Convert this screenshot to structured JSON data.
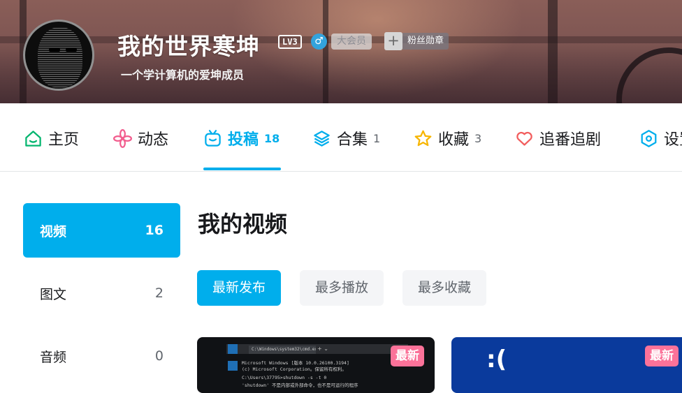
{
  "profile": {
    "name": "我的世界寒坤",
    "level": "LV3",
    "gender_symbol": "♂",
    "vip": "大会员",
    "fan_badge_plus": "+",
    "fan_badge": "粉丝勋章",
    "bio": "一个学计算机的爱坤成员"
  },
  "tabs": [
    {
      "label": "主页",
      "count": "",
      "icon": "home-icon",
      "color": "#04b56f"
    },
    {
      "label": "动态",
      "count": "",
      "icon": "dynamic-icon",
      "color": "#f25d8e"
    },
    {
      "label": "投稿",
      "count": "18",
      "icon": "tv-icon",
      "color": "#00aeec",
      "active": true
    },
    {
      "label": "合集",
      "count": "1",
      "icon": "layers-icon",
      "color": "#00aeec"
    },
    {
      "label": "收藏",
      "count": "3",
      "icon": "star-icon",
      "color": "#f7b500"
    },
    {
      "label": "追番追剧",
      "count": "",
      "icon": "heart-icon",
      "color": "#f25d5d"
    },
    {
      "label": "设置",
      "count": "",
      "icon": "settings-icon",
      "color": "#00aeec"
    }
  ],
  "sidebar": {
    "items": [
      {
        "label": "视频",
        "count": "16",
        "active": true
      },
      {
        "label": "图文",
        "count": "2"
      },
      {
        "label": "音频",
        "count": "0"
      }
    ]
  },
  "main": {
    "title": "我的视频",
    "sort": [
      {
        "label": "最新发布",
        "active": true
      },
      {
        "label": "最多播放"
      },
      {
        "label": "最多收藏"
      }
    ],
    "videos": [
      {
        "badge": "最新",
        "cmd_title": "C:\\Windows\\system32\\cmd.exe",
        "cmd_plus": "+  ⌄",
        "lines": [
          "Microsoft Windows [版本 10.0.26100.3194]",
          "(c) Microsoft Corporation。保留所有权利。",
          "C:\\Users\\37795>shutdown -s -t 0",
          "'shutdown' 不是内部或外部命令，也不是可运行的程序"
        ]
      },
      {
        "badge": "最新",
        "screen_text": ":("
      }
    ]
  },
  "colors": {
    "accent": "#00aeec",
    "pink": "#fb7299"
  }
}
